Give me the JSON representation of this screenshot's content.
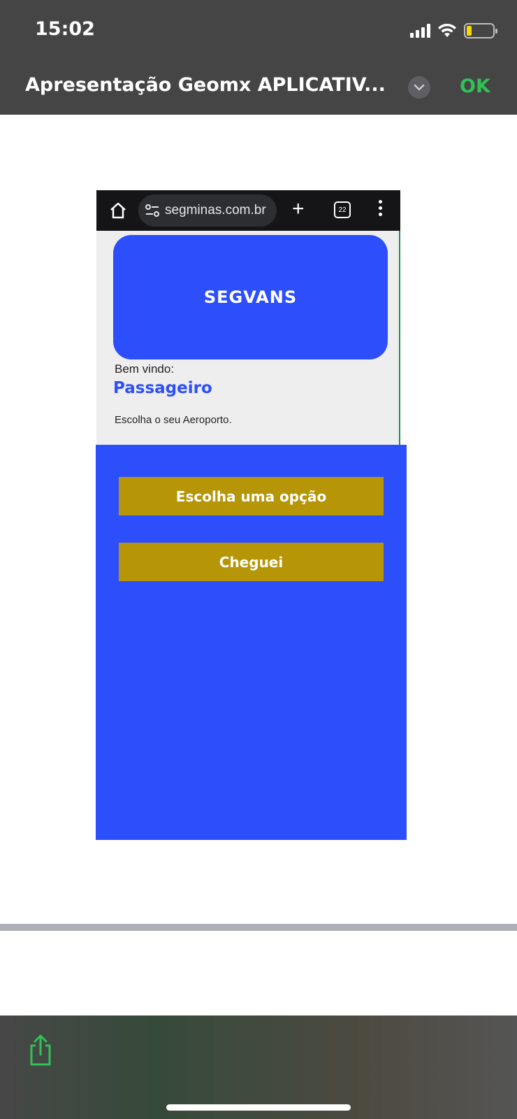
{
  "status_bar": {
    "time": "15:02"
  },
  "header": {
    "title": "Apresentação Geomx APLICATIV...",
    "ok_label": "OK",
    "ok_color": "#30c254"
  },
  "browser": {
    "url": "segminas.com.br",
    "tab_count": "22"
  },
  "app": {
    "brand": "SEGVANS",
    "welcome_label": "Bem vindo:",
    "user_role": "Passageiro",
    "instruction": "Escolha o seu Aeroporto.",
    "primary_color": "#2d4ffb",
    "button_color": "#b69506",
    "buttons": [
      {
        "label": "Escolha uma opção"
      },
      {
        "label": "Cheguei"
      }
    ]
  },
  "icons": {
    "share": "share-icon",
    "home": "home-icon",
    "chevron": "chevron-down-icon"
  }
}
